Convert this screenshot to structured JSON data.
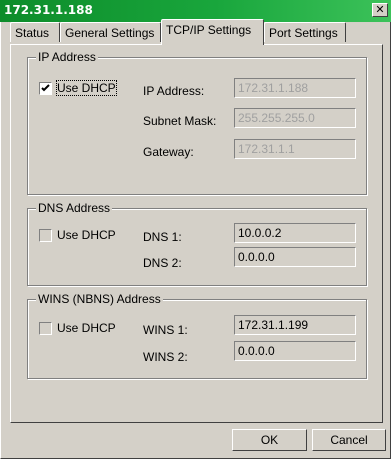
{
  "window": {
    "title": "172.31.1.188"
  },
  "tabs": [
    {
      "label": "Status"
    },
    {
      "label": "General Settings"
    },
    {
      "label": "TCP/IP Settings"
    },
    {
      "label": "Port Settings"
    }
  ],
  "ip_group": {
    "legend": "IP Address",
    "dhcp_label": "Use DHCP",
    "dhcp_checked": true,
    "ip_label": "IP Address:",
    "ip_value": "172.31.1.188",
    "mask_label": "Subnet Mask:",
    "mask_value": "255.255.255.0",
    "gateway_label": "Gateway:",
    "gateway_value": "172.31.1.1"
  },
  "dns_group": {
    "legend": "DNS Address",
    "dhcp_label": "Use DHCP",
    "dhcp_checked": false,
    "dns1_label": "DNS 1:",
    "dns1_value": "10.0.0.2",
    "dns2_label": "DNS 2:",
    "dns2_value": "0.0.0.0"
  },
  "wins_group": {
    "legend": "WINS (NBNS) Address",
    "dhcp_label": "Use DHCP",
    "dhcp_checked": false,
    "wins1_label": "WINS 1:",
    "wins1_value": "172.31.1.199",
    "wins2_label": "WINS 2:",
    "wins2_value": "0.0.0.0"
  },
  "buttons": {
    "ok": "OK",
    "cancel": "Cancel"
  },
  "icons": {
    "close": "close-icon",
    "check": "checkmark-icon"
  }
}
